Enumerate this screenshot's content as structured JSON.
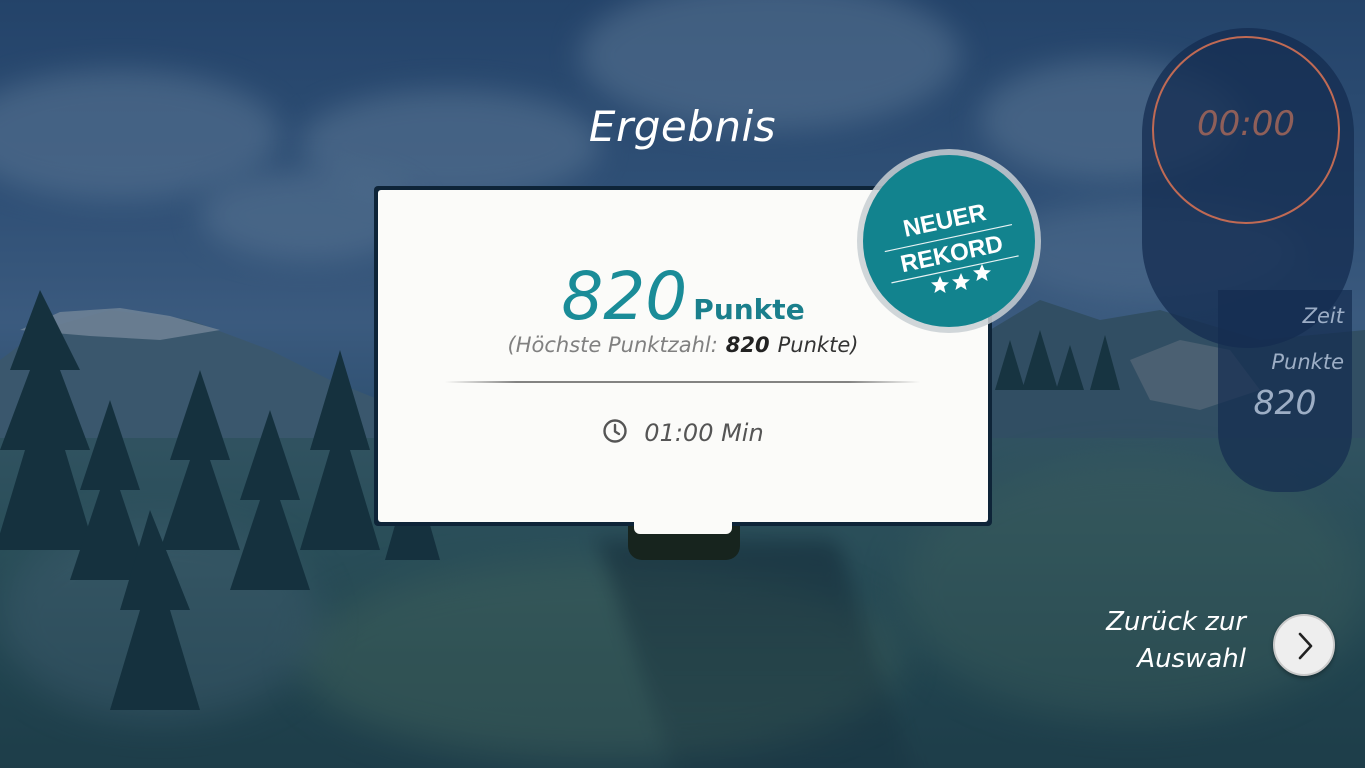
{
  "screen": {
    "title": "Ergebnis"
  },
  "result": {
    "score_value": "820",
    "score_unit": "Punkte",
    "best_prefix": "(Höchste Punktzahl:",
    "best_value": "820",
    "best_suffix": "Punkte)",
    "duration": "01:00 Min"
  },
  "badge": {
    "line1": "NEUER",
    "line2": "REKORD",
    "stars": 3,
    "color": "#12838e"
  },
  "hud": {
    "timer": "00:00",
    "zeit_label": "Zeit",
    "punkte_label": "Punkte",
    "punkte_value": "820"
  },
  "navigation": {
    "back_line1": "Zurück zur",
    "back_line2": "Auswahl"
  },
  "colors": {
    "accent": "#1a8c98",
    "timer_ring": "#c06a54"
  },
  "icons": {
    "duration": "clock-icon",
    "back": "chevron-right-icon",
    "badge_stars": "star-icon"
  }
}
